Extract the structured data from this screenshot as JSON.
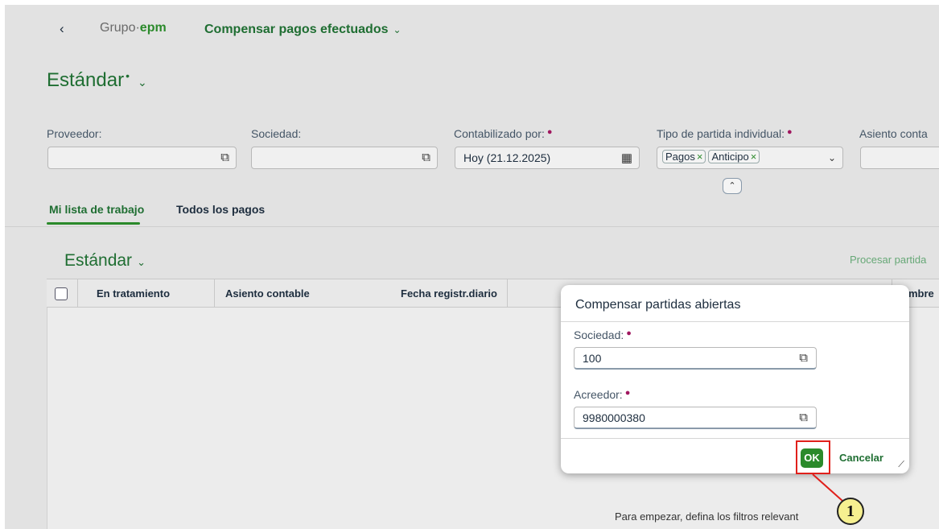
{
  "header": {
    "back_glyph": "‹",
    "logo_prefix": "Grupo·",
    "logo_brand": "epm",
    "app_title": "Compensar pagos efectuados",
    "variant_name": "Estándar"
  },
  "filters": [
    {
      "label": "Proveedor:",
      "value": "",
      "required": false
    },
    {
      "label": "Sociedad:",
      "value": "",
      "required": false
    },
    {
      "label": "Contabilizado por:",
      "value": "Hoy (21.12.2025)",
      "required": true
    },
    {
      "label": "Tipo de partida individual:",
      "tokens": [
        "Pagos",
        "Anticipo"
      ],
      "required": true
    },
    {
      "label": "Asiento conta",
      "value": "",
      "required": false
    }
  ],
  "tabs": [
    {
      "label": "Mi lista de trabajo",
      "selected": true
    },
    {
      "label": "Todos los pagos",
      "selected": false
    }
  ],
  "table": {
    "variant": "Estándar",
    "action": "Procesar partida",
    "columns": [
      "En tratamiento",
      "Asiento contable",
      "Fecha registr.diario",
      "ombre"
    ],
    "empty_text": "Para empezar, defina los filtros relevant"
  },
  "dialog": {
    "title": "Compensar partidas abiertas",
    "fields": [
      {
        "label": "Sociedad:",
        "value": "100"
      },
      {
        "label": "Acreedor:",
        "value": "9980000380"
      }
    ],
    "ok_label": "OK",
    "cancel_label": "Cancelar"
  },
  "annotation": {
    "badge_number": "1",
    "color": "#e0201b"
  },
  "colors": {
    "brand": "#1f6e32",
    "accent": "#2b8a2b",
    "required": "#a0175f"
  },
  "icons": [
    "value-help-icon",
    "calendar-icon",
    "chevron-down-icon",
    "collapse-icon",
    "resize-icon"
  ]
}
